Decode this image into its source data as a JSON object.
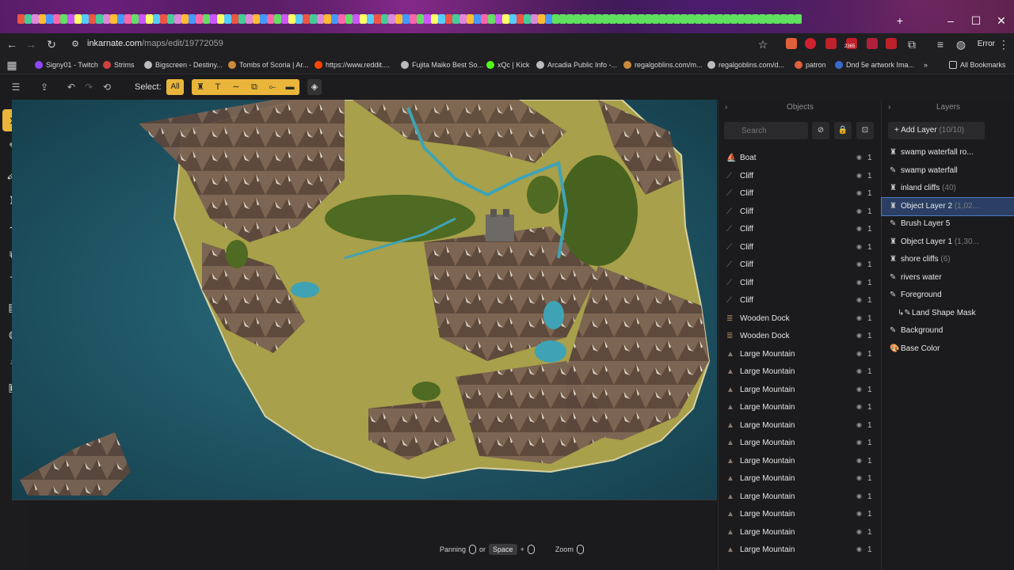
{
  "browser": {
    "url_host": "inkarnate.com",
    "url_path": "/maps/edit/19772059",
    "error_label": "Error",
    "ext_badge": "2365",
    "bookmarks": [
      {
        "label": "Signy01 - Twitch",
        "color": "#9146ff"
      },
      {
        "label": "Strims",
        "color": "#d04040"
      },
      {
        "label": "Bigscreen - Destiny...",
        "color": "#bbbbbb"
      },
      {
        "label": "Tombs of Scoria | Ar...",
        "color": "#c98a3a"
      },
      {
        "label": "https://www.reddit....",
        "color": "#ff4500"
      },
      {
        "label": "Fujita Maiko Best So...",
        "color": "#bbbbbb"
      },
      {
        "label": "xQc | Kick",
        "color": "#53fc18"
      },
      {
        "label": "Arcadia Public Info -...",
        "color": "#bbbbbb"
      },
      {
        "label": "regalgoblins.com/m...",
        "color": "#c98a3a"
      },
      {
        "label": "regalgoblins.com/d...",
        "color": "#bbbbbb"
      },
      {
        "label": "patron",
        "color": "#e0603a"
      },
      {
        "label": "Dnd 5e artwork Ima...",
        "color": "#3a6ad0"
      }
    ],
    "all_bookmarks": "All Bookmarks"
  },
  "toolbar": {
    "select_label": "Select:",
    "all_label": "All"
  },
  "objects": {
    "title": "Objects",
    "search_placeholder": "Search",
    "items": [
      {
        "name": "Boat",
        "count": "1",
        "icon": "boat-icon"
      },
      {
        "name": "Cliff",
        "count": "1",
        "icon": "cliff-icon"
      },
      {
        "name": "Cliff",
        "count": "1",
        "icon": "cliff-icon"
      },
      {
        "name": "Cliff",
        "count": "1",
        "icon": "cliff-icon"
      },
      {
        "name": "Cliff",
        "count": "1",
        "icon": "cliff-icon"
      },
      {
        "name": "Cliff",
        "count": "1",
        "icon": "cliff-icon"
      },
      {
        "name": "Cliff",
        "count": "1",
        "icon": "cliff-icon"
      },
      {
        "name": "Cliff",
        "count": "1",
        "icon": "cliff-icon"
      },
      {
        "name": "Cliff",
        "count": "1",
        "icon": "cliff-icon"
      },
      {
        "name": "Wooden Dock",
        "count": "1",
        "icon": "dock-icon"
      },
      {
        "name": "Wooden Dock",
        "count": "1",
        "icon": "dock-icon"
      },
      {
        "name": "Large Mountain",
        "count": "1",
        "icon": "mountain-icon"
      },
      {
        "name": "Large Mountain",
        "count": "1",
        "icon": "mountain-icon"
      },
      {
        "name": "Large Mountain",
        "count": "1",
        "icon": "mountain-icon"
      },
      {
        "name": "Large Mountain",
        "count": "1",
        "icon": "mountain-icon"
      },
      {
        "name": "Large Mountain",
        "count": "1",
        "icon": "mountain-icon"
      },
      {
        "name": "Large Mountain",
        "count": "1",
        "icon": "mountain-icon"
      },
      {
        "name": "Large Mountain",
        "count": "1",
        "icon": "mountain-icon"
      },
      {
        "name": "Large Mountain",
        "count": "1",
        "icon": "mountain-icon"
      },
      {
        "name": "Large Mountain",
        "count": "1",
        "icon": "mountain-icon"
      },
      {
        "name": "Large Mountain",
        "count": "1",
        "icon": "mountain-icon"
      },
      {
        "name": "Large Mountain",
        "count": "1",
        "icon": "mountain-icon"
      },
      {
        "name": "Large Mountain",
        "count": "1",
        "icon": "mountain-icon"
      }
    ]
  },
  "layers": {
    "title": "Layers",
    "add_label": "Add Layer",
    "add_count": "(10/10)",
    "items": [
      {
        "name": "swamp waterfall ro...",
        "meta": "",
        "icon": "object-layer-icon",
        "selected": false
      },
      {
        "name": "swamp waterfall",
        "meta": "",
        "icon": "brush-layer-icon",
        "selected": false
      },
      {
        "name": "inland cliffs",
        "meta": "(40)",
        "icon": "object-layer-icon",
        "selected": false
      },
      {
        "name": "Object Layer 2",
        "meta": "(1,02...",
        "icon": "object-layer-icon",
        "selected": true
      },
      {
        "name": "Brush Layer 5",
        "meta": "",
        "icon": "brush-layer-icon",
        "selected": false
      },
      {
        "name": "Object Layer 1",
        "meta": "(1,30...",
        "icon": "object-layer-icon",
        "selected": false
      },
      {
        "name": "shore cliffs",
        "meta": "(6)",
        "icon": "object-layer-icon",
        "selected": false
      },
      {
        "name": "rivers water",
        "meta": "",
        "icon": "brush-layer-icon",
        "selected": false
      },
      {
        "name": "Foreground",
        "meta": "",
        "icon": "brush-layer-icon",
        "selected": false
      },
      {
        "name": "Land Shape Mask",
        "meta": "",
        "icon": "mask-layer-icon",
        "selected": false
      },
      {
        "name": "Background",
        "meta": "",
        "icon": "brush-layer-icon",
        "selected": false
      },
      {
        "name": "Base Color",
        "meta": "",
        "icon": "color-layer-icon",
        "selected": false
      }
    ]
  },
  "hint": {
    "panning": "Panning",
    "or": "or",
    "space": "Space",
    "plus": "+",
    "zoom": "Zoom"
  },
  "colors": {
    "accent": "#e9b53a",
    "water": "#1e5668",
    "land": "#a8a04a",
    "selected_layer": "#2a3f63"
  }
}
